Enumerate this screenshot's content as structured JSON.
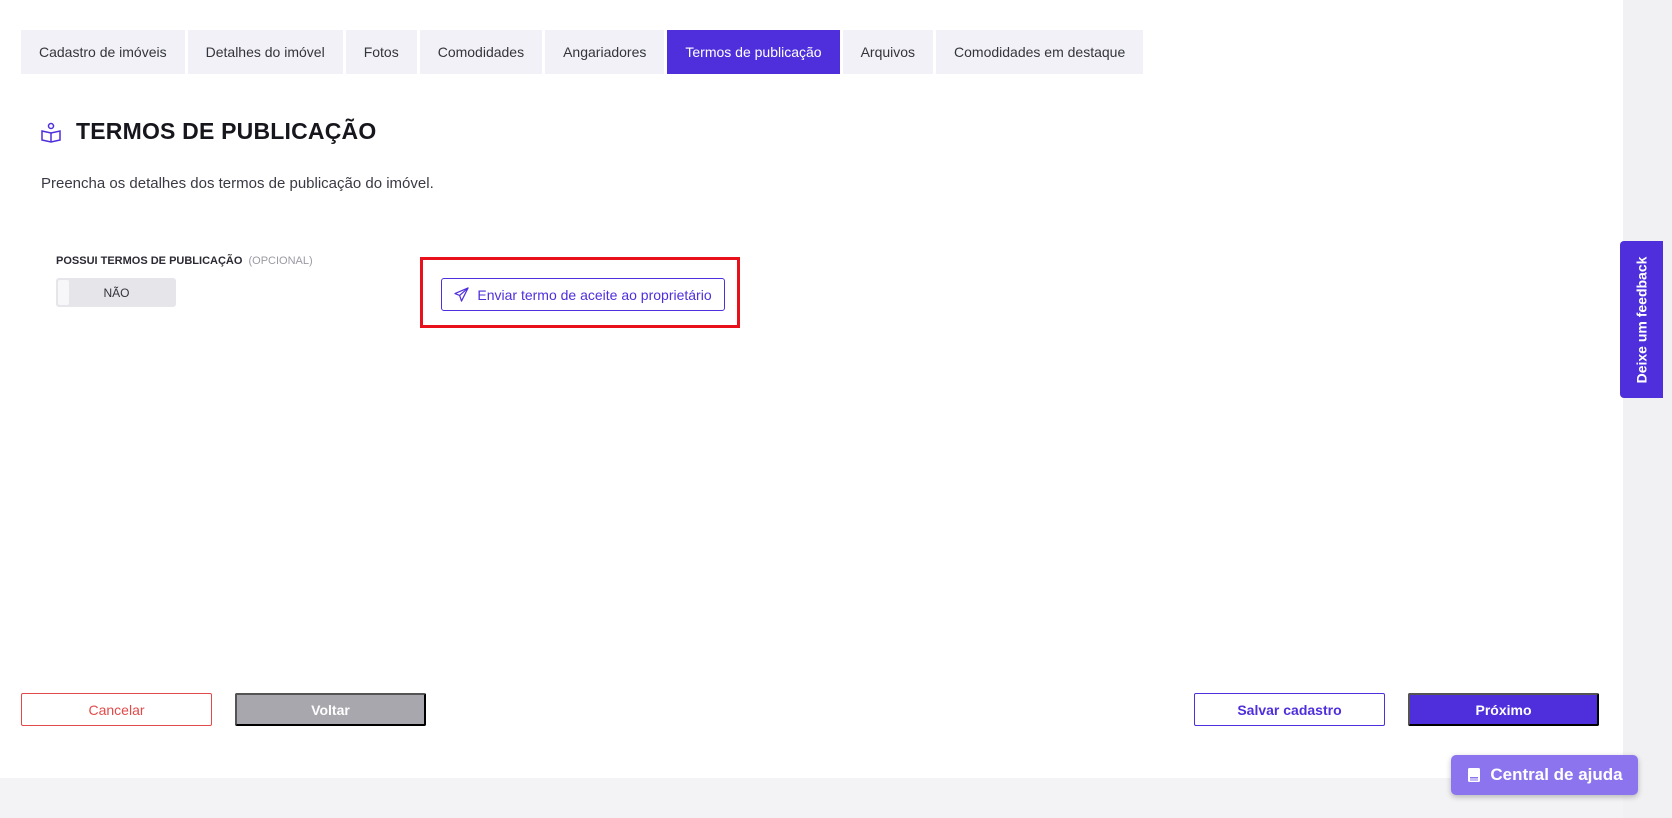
{
  "tabs": [
    {
      "label": "Cadastro de imóveis"
    },
    {
      "label": "Detalhes do imóvel"
    },
    {
      "label": "Fotos"
    },
    {
      "label": "Comodidades"
    },
    {
      "label": "Angariadores"
    },
    {
      "label": "Termos de publicação",
      "active": true
    },
    {
      "label": "Arquivos"
    },
    {
      "label": "Comodidades em destaque"
    }
  ],
  "section": {
    "icon": "book-reader-icon",
    "title": "TERMOS DE PUBLICAÇÃO",
    "description": "Preencha os detalhes dos termos de publicação do imóvel."
  },
  "field": {
    "label": "POSSUI TERMOS DE PUBLICAÇÃO",
    "optional": "(OPCIONAL)",
    "toggle_value": "NÃO"
  },
  "send_term": {
    "icon": "paper-plane-icon",
    "label": "Enviar termo de aceite ao proprietário"
  },
  "footer": {
    "cancel": "Cancelar",
    "back": "Voltar",
    "save": "Salvar cadastro",
    "next": "Próximo"
  },
  "feedback": {
    "label": "Deixe um feedback"
  },
  "help": {
    "icon": "book-icon",
    "label": "Central de ajuda"
  },
  "colors": {
    "primary": "#4f2fdc",
    "danger": "#e24a4a",
    "highlight": "#e8111b",
    "muted_button": "#a7a7ad",
    "help_button": "#8c74ee"
  }
}
